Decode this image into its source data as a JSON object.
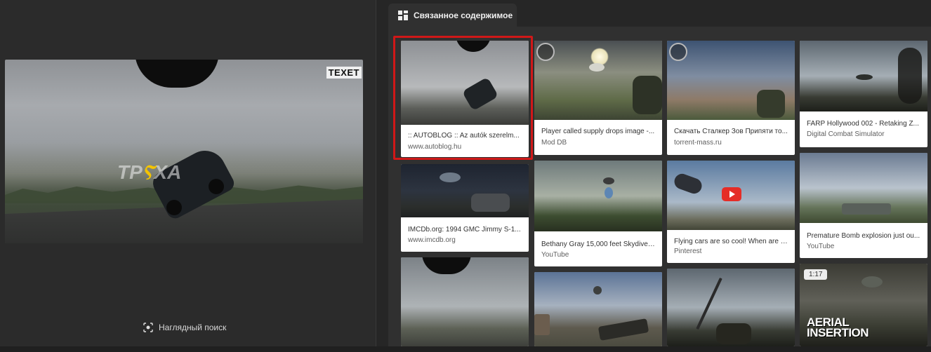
{
  "left": {
    "preview": {
      "brand_text": "TEXET",
      "watermark_pre": "TP",
      "watermark_bolt": "Ⲋ",
      "watermark_post": "XA"
    },
    "visual_search_label": "Наглядный поиск",
    "visual_search_icon": "lens-scan-icon"
  },
  "right": {
    "tab_label": "Связанное содержимое",
    "tab_icon": "grid-icon",
    "cards": [
      {
        "title": ":: AUTOBLOG :: Az autók szerelm...",
        "source": "www.autoblog.hu",
        "selected": true
      },
      {
        "title": "IMCDb.org: 1994 GMC Jimmy S-1...",
        "source": "www.imcdb.org"
      },
      {
        "title": "",
        "source": ""
      },
      {
        "title": "Player called supply drops image -...",
        "source": "Mod DB"
      },
      {
        "title": "Bethany Gray 15,000 feet Skydive ...",
        "source": "YouTube"
      },
      {
        "title": "",
        "source": ""
      },
      {
        "title": "Скачать Сталкер Зов Припяти то...",
        "source": "torrent-mass.ru"
      },
      {
        "title": "Flying cars are so cool! When are t...",
        "source": "Pinterest"
      },
      {
        "title": "",
        "source": ""
      },
      {
        "title": "FARP Hollywood 002 - Retaking Z...",
        "source": "Digital Combat Simulator"
      },
      {
        "title": "Premature Bomb explosion just ou...",
        "source": "YouTube"
      },
      {
        "title": "",
        "source": "",
        "duration": "1:17",
        "overlay_line1": "AERIAL",
        "overlay_line2": "INSERTION"
      }
    ]
  }
}
